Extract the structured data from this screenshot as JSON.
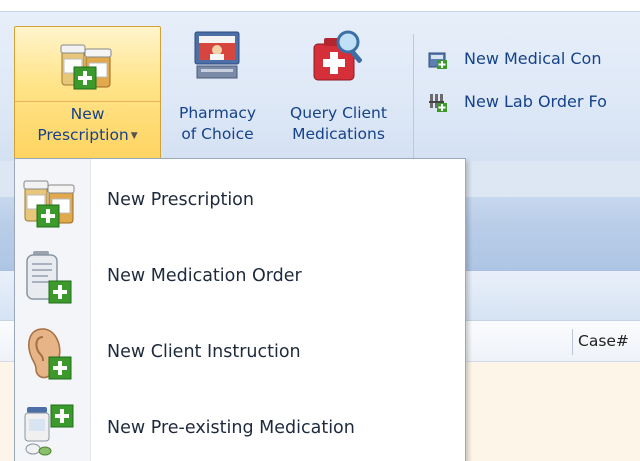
{
  "ribbon": {
    "new_prescription": {
      "line1": "New",
      "line2": "Prescription"
    },
    "pharmacy": {
      "line1": "Pharmacy",
      "line2": "of Choice"
    },
    "query": {
      "line1": "Query Client",
      "line2": "Medications"
    },
    "small_items": [
      {
        "label": "New Medical Con",
        "icon": "medical-record-icon"
      },
      {
        "label": "New Lab Order Fo",
        "icon": "lab-order-icon"
      }
    ]
  },
  "grid": {
    "case_header": "Case#"
  },
  "dropdown": {
    "items": [
      {
        "label": "New Prescription",
        "icon": "pill-bottles-add-icon"
      },
      {
        "label": "New Medication Order",
        "icon": "iv-bag-add-icon"
      },
      {
        "label": "New Client Instruction",
        "icon": "ear-add-icon"
      },
      {
        "label": "New Pre-existing Medication",
        "icon": "pill-jar-add-icon"
      }
    ]
  },
  "colors": {
    "ribbon_text": "#15428b",
    "selected_button": "#ffd25c",
    "plus_badge": "#3c9a2c"
  }
}
